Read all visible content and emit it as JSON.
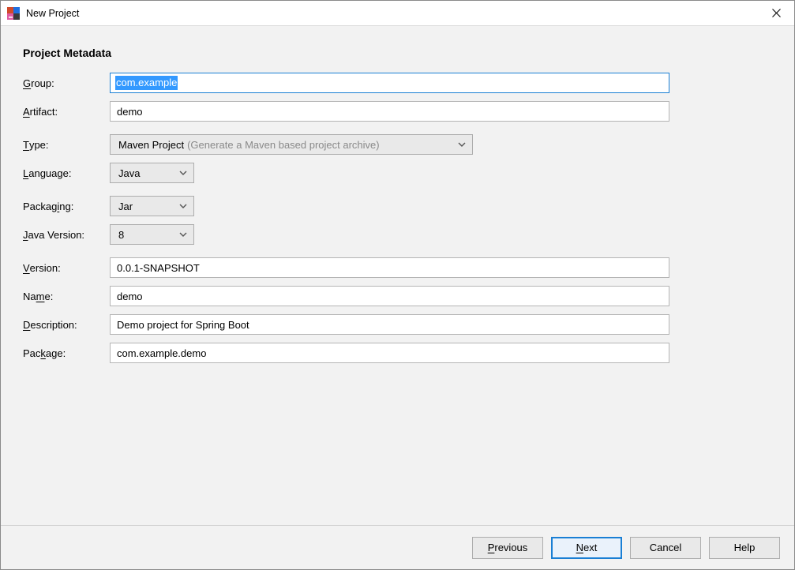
{
  "window": {
    "title": "New Project"
  },
  "heading": "Project Metadata",
  "labels": {
    "group": {
      "pre": "",
      "mn": "G",
      "post": "roup:"
    },
    "artifact": {
      "pre": "",
      "mn": "A",
      "post": "rtifact:"
    },
    "type": {
      "pre": "",
      "mn": "T",
      "post": "ype:"
    },
    "language": {
      "pre": "",
      "mn": "L",
      "post": "anguage:"
    },
    "packaging": {
      "pre": "Packag",
      "mn": "i",
      "post": "ng:"
    },
    "java_version": {
      "pre": "",
      "mn": "J",
      "post": "ava Version:"
    },
    "version": {
      "pre": "",
      "mn": "V",
      "post": "ersion:"
    },
    "name": {
      "pre": "Na",
      "mn": "m",
      "post": "e:"
    },
    "description": {
      "pre": "",
      "mn": "D",
      "post": "escription:"
    },
    "package": {
      "pre": "Pac",
      "mn": "k",
      "post": "age:"
    }
  },
  "fields": {
    "group": "com.example",
    "artifact": "demo",
    "type_value": "Maven Project",
    "type_hint": "(Generate a Maven based project archive)",
    "language": "Java",
    "packaging": "Jar",
    "java_version": "8",
    "version": "0.0.1-SNAPSHOT",
    "name": "demo",
    "description": "Demo project for Spring Boot",
    "package": "com.example.demo"
  },
  "buttons": {
    "previous": {
      "pre": "",
      "mn": "P",
      "post": "revious"
    },
    "next": {
      "pre": "",
      "mn": "N",
      "post": "ext"
    },
    "cancel": "Cancel",
    "help": "Help"
  }
}
